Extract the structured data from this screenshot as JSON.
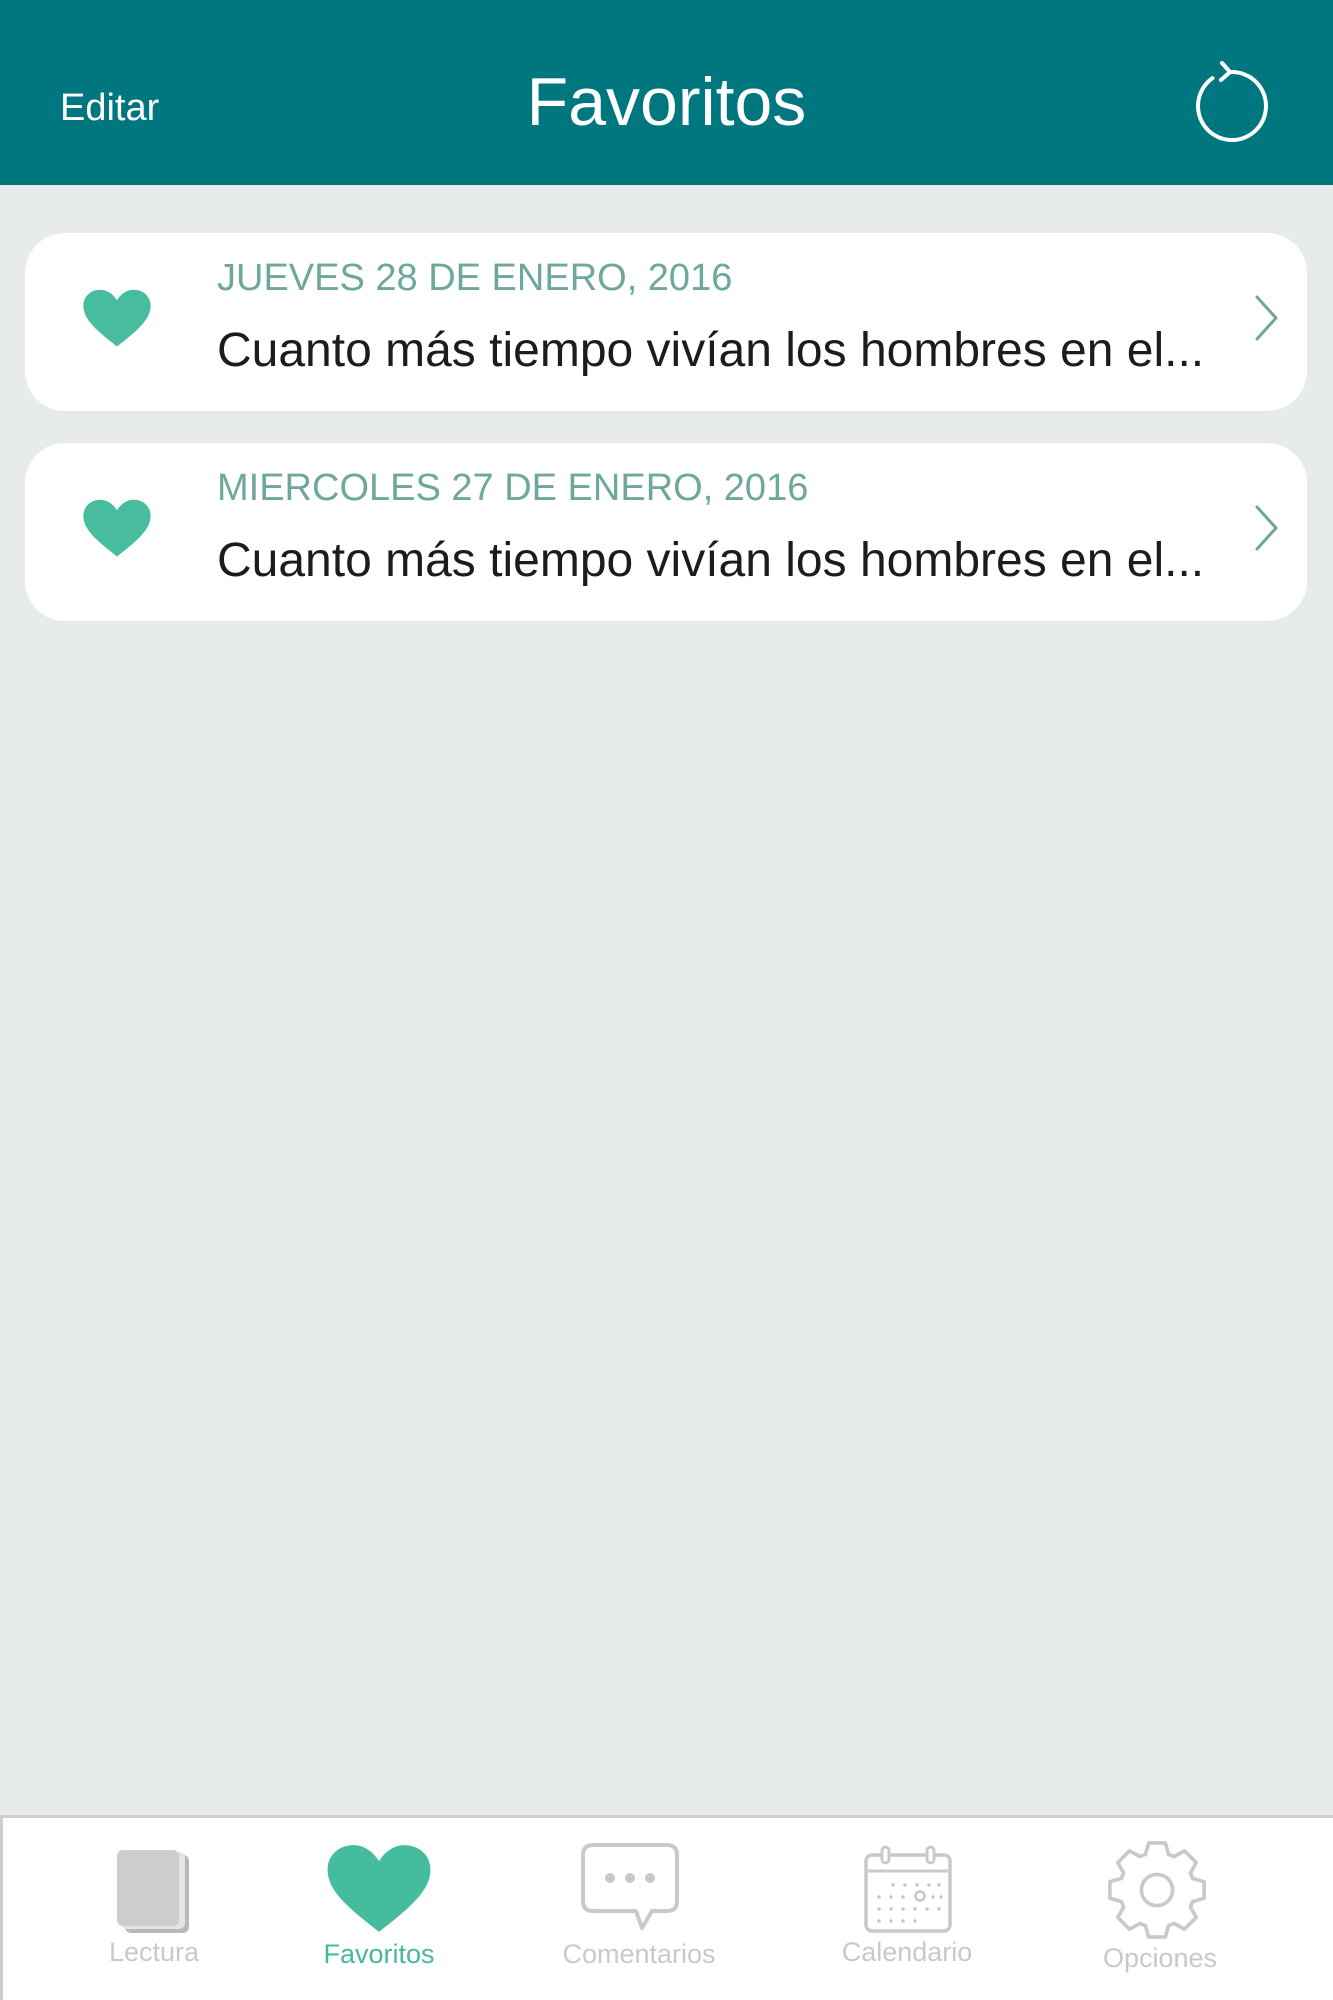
{
  "header": {
    "edit_label": "Editar",
    "title": "Favoritos",
    "refresh_icon": "refresh-icon"
  },
  "favorites": [
    {
      "icon": "heart-icon",
      "date": "JUEVES 28 DE ENERO, 2016",
      "excerpt": "Cuanto más tiempo vivían los hombres en el...",
      "chevron_icon": "chevron-right-icon"
    },
    {
      "icon": "heart-icon",
      "date": "MIERCOLES 27 DE ENERO, 2016",
      "excerpt": "Cuanto más tiempo vivían los hombres en el...",
      "chevron_icon": "chevron-right-icon"
    }
  ],
  "tabbar": {
    "items": [
      {
        "label": "Lectura",
        "icon": "book-icon",
        "active": false
      },
      {
        "label": "Favoritos",
        "icon": "heart-icon",
        "active": true
      },
      {
        "label": "Comentarios",
        "icon": "chat-bubble-icon",
        "active": false
      },
      {
        "label": "Calendario",
        "icon": "calendar-icon",
        "active": false
      },
      {
        "label": "Opciones",
        "icon": "gear-icon",
        "active": false
      }
    ]
  },
  "colors": {
    "header_bg": "#00777f",
    "accent": "#45b99b",
    "date_text": "#6ea89c",
    "background": "#e7ebec",
    "tab_inactive": "#c9c9c9"
  }
}
